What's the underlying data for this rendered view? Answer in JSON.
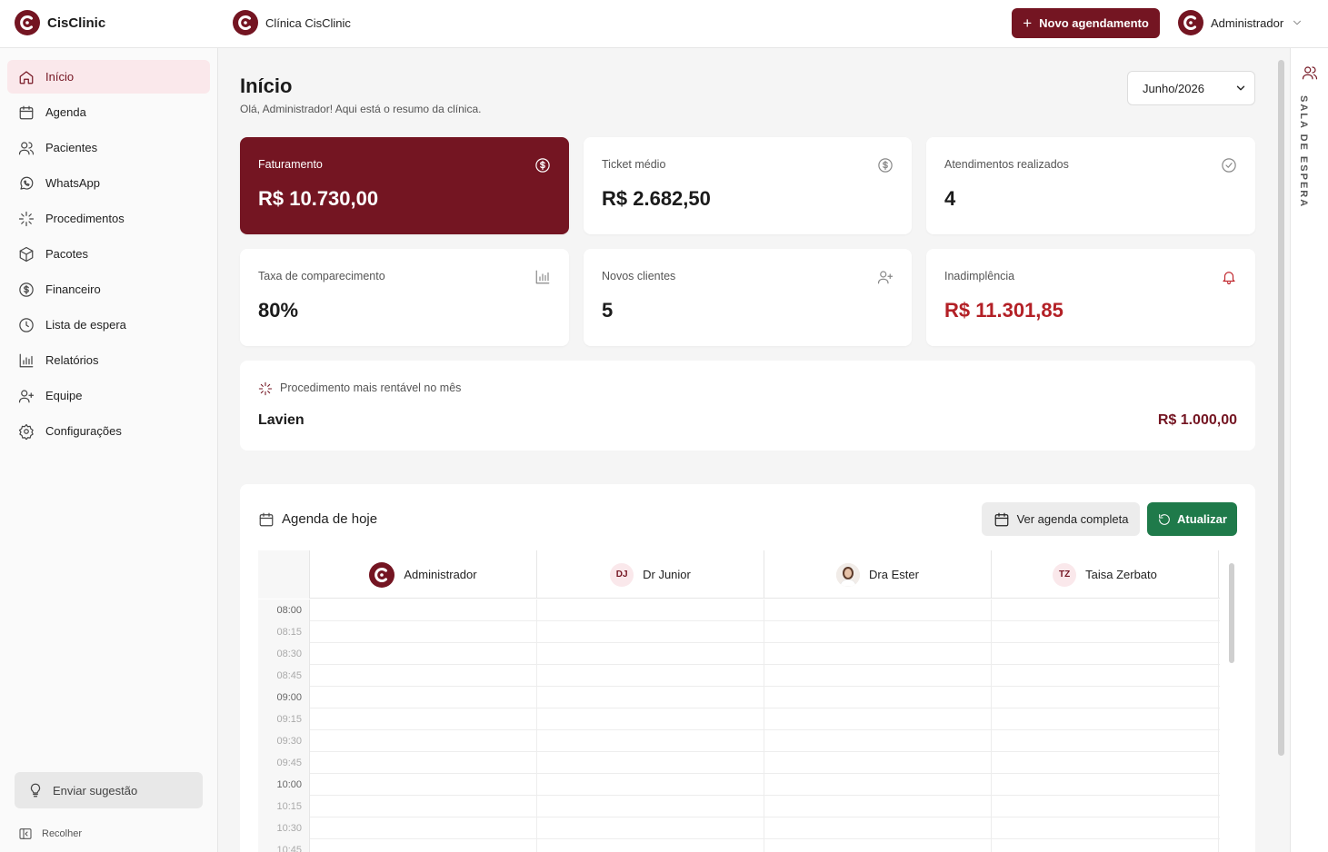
{
  "topbar": {
    "brand_name": "CisClinic",
    "clinic_name": "Clínica CisClinic",
    "new_appointment_label": "Novo agendamento",
    "user_name": "Administrador"
  },
  "sidebar": {
    "items": [
      {
        "label": "Início",
        "icon": "home-icon",
        "active": true
      },
      {
        "label": "Agenda",
        "icon": "calendar-icon"
      },
      {
        "label": "Pacientes",
        "icon": "users-icon"
      },
      {
        "label": "WhatsApp",
        "icon": "whatsapp-icon"
      },
      {
        "label": "Procedimentos",
        "icon": "sparkle-icon"
      },
      {
        "label": "Pacotes",
        "icon": "box-icon"
      },
      {
        "label": "Financeiro",
        "icon": "dollar-icon"
      },
      {
        "label": "Lista de espera",
        "icon": "clock-icon"
      },
      {
        "label": "Relatórios",
        "icon": "bar-chart-icon"
      },
      {
        "label": "Equipe",
        "icon": "user-plus-icon"
      },
      {
        "label": "Configurações",
        "icon": "gear-icon"
      }
    ],
    "suggestion_label": "Enviar sugestão",
    "collapse_label": "Recolher"
  },
  "main": {
    "title": "Início",
    "subtitle": "Olá, Administrador! Aqui está o resumo da clínica.",
    "month_selected": "Junho/2026"
  },
  "cards": [
    {
      "label": "Faturamento",
      "value": "R$ 10.730,00",
      "icon": "dollar-icon"
    },
    {
      "label": "Ticket médio",
      "value": "R$ 2.682,50",
      "icon": "dollar-icon"
    },
    {
      "label": "Atendimentos realizados",
      "value": "4",
      "icon": "check-circle-icon"
    },
    {
      "label": "Taxa de comparecimento",
      "value": "80%",
      "icon": "bar-chart-icon"
    },
    {
      "label": "Novos clientes",
      "value": "5",
      "icon": "user-plus-icon"
    },
    {
      "label": "Inadimplência",
      "value": "R$ 11.301,85",
      "icon": "bell-icon"
    }
  ],
  "top_procedure": {
    "label": "Procedimento mais rentável no mês",
    "name": "Lavien",
    "value": "R$ 1.000,00"
  },
  "agenda": {
    "title": "Agenda de hoje",
    "view_full_label": "Ver agenda completa",
    "refresh_label": "Atualizar",
    "professionals": [
      {
        "name": "Administrador",
        "avatar": "logo"
      },
      {
        "name": "Dr Junior",
        "initials": "DJ"
      },
      {
        "name": "Dra Ester",
        "avatar": "photo"
      },
      {
        "name": "Taisa Zerbato",
        "initials": "TZ"
      }
    ],
    "times": [
      "08:00",
      "08:15",
      "08:30",
      "08:45",
      "09:00",
      "09:15",
      "09:30",
      "09:45",
      "10:00",
      "10:15",
      "10:30",
      "10:45"
    ]
  },
  "waiting_room": {
    "label": "SALA DE ESPERA"
  },
  "colors": {
    "brand": "#741522",
    "success": "#1f7a4a",
    "danger": "#b32026"
  }
}
